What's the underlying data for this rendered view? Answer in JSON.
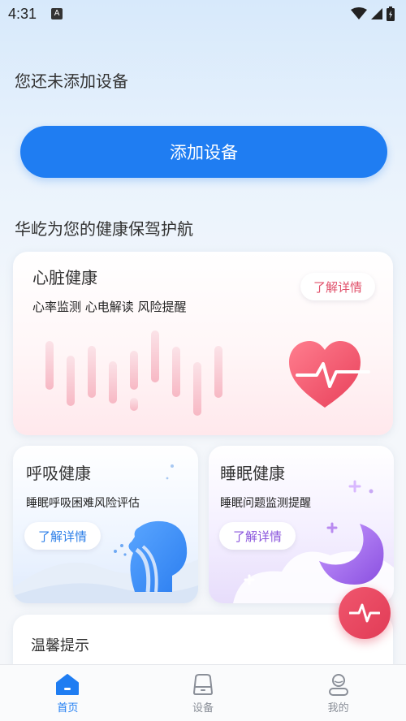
{
  "status_bar": {
    "time": "4:31",
    "notification_icon": "A"
  },
  "home": {
    "no_device_text": "您还未添加设备",
    "add_device_label": "添加设备",
    "section_title": "华屹为您的健康保驾护航"
  },
  "cards": {
    "heart": {
      "title": "心脏健康",
      "subtitle": "心率监测 心电解读 风险提醒",
      "detail_label": "了解详情"
    },
    "breath": {
      "title": "呼吸健康",
      "subtitle": "睡眠呼吸困难风险评估",
      "detail_label": "了解详情"
    },
    "sleep": {
      "title": "睡眠健康",
      "subtitle": "睡眠问题监测提醒",
      "detail_label": "了解详情"
    },
    "tips": {
      "title": "温馨提示"
    }
  },
  "tab_bar": {
    "items": [
      {
        "label": "首页",
        "icon": "home-icon",
        "active": true
      },
      {
        "label": "设备",
        "icon": "device-icon",
        "active": false
      },
      {
        "label": "我的",
        "icon": "profile-icon",
        "active": false
      }
    ]
  },
  "colors": {
    "primary": "#1f7df2",
    "heart_accent": "#e0506a",
    "sleep_accent": "#8a55dc"
  }
}
